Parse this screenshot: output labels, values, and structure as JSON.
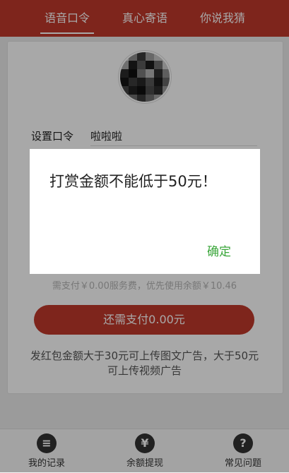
{
  "tabs": [
    {
      "label": "语音口令"
    },
    {
      "label": "真心寄语"
    },
    {
      "label": "你说我猜"
    }
  ],
  "form": {
    "password_label": "设置口令",
    "password_value": "啦啦啦"
  },
  "fee_text": "需支付￥0.00服务费，优先使用余额￥10.46",
  "pay_button_label": "还需支付0.00元",
  "note_text": "发红包金额大于30元可上传图文广告，大于50元可上传视频广告",
  "dialog": {
    "message": "打赏金额不能低于50元！",
    "ok_label": "确定"
  },
  "bottom_nav": [
    {
      "label": "我的记录",
      "icon": "list-icon"
    },
    {
      "label": "余额提现",
      "icon": "yen-icon"
    },
    {
      "label": "常见问题",
      "icon": "question-icon"
    }
  ],
  "colors": {
    "brand": "#c0392b",
    "confirm": "#3aa63a"
  }
}
